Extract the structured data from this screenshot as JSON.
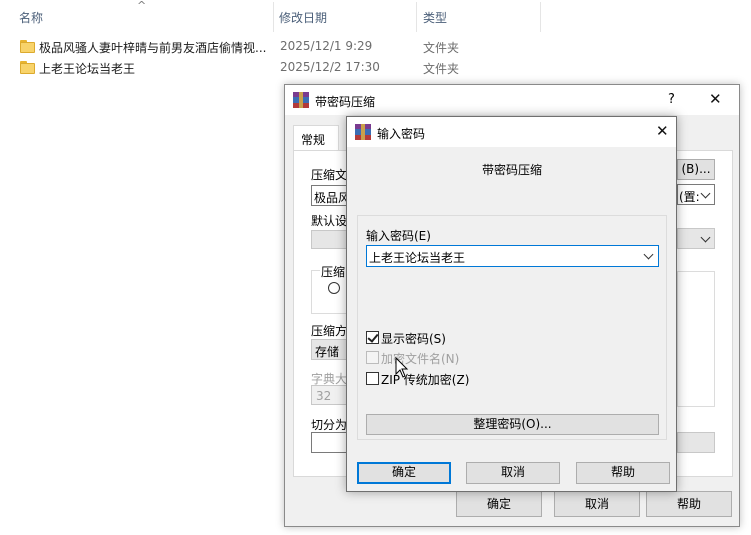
{
  "explorer": {
    "columns": {
      "name": "名称",
      "date": "修改日期",
      "type": "类型"
    },
    "files": [
      {
        "name": "极品风骚人妻叶梓晴与前男友酒店偷情视...",
        "date": "2025/12/1 9:29",
        "type": "文件夹"
      },
      {
        "name": "上老王论坛当老王",
        "date": "2025/12/2 17:30",
        "type": "文件夹"
      }
    ]
  },
  "main_dialog": {
    "title": "带密码压缩",
    "help": "?",
    "tab_general": "常规",
    "label_archive": "压缩文",
    "archive_value": "极品风",
    "browse_button": "(B)...",
    "profile_label": "默认设",
    "update_mode_partial": "(置:",
    "format_group": "压缩",
    "method_label": "压缩方",
    "method_value": "存储",
    "dict_label": "字典大",
    "dict_value": "32",
    "split_label": "切分为",
    "ok": "确定",
    "cancel": "取消",
    "help_button": "帮助"
  },
  "password_dialog": {
    "title": "输入密码",
    "subtitle": "带密码压缩",
    "password_label": "输入密码(E)",
    "password_value": "上老王论坛当老王",
    "show_password": "显示密码(S)",
    "encrypt_names": "加密文件名(N)",
    "zip_legacy": "ZIP 传统加密(Z)",
    "organize_button": "整理密码(O)...",
    "ok": "确定",
    "cancel": "取消",
    "help": "帮助",
    "show_password_checked": true,
    "encrypt_names_enabled": false,
    "zip_legacy_checked": false
  },
  "colors": {
    "accent": "#0078d7",
    "folder": "#f8d36a"
  }
}
